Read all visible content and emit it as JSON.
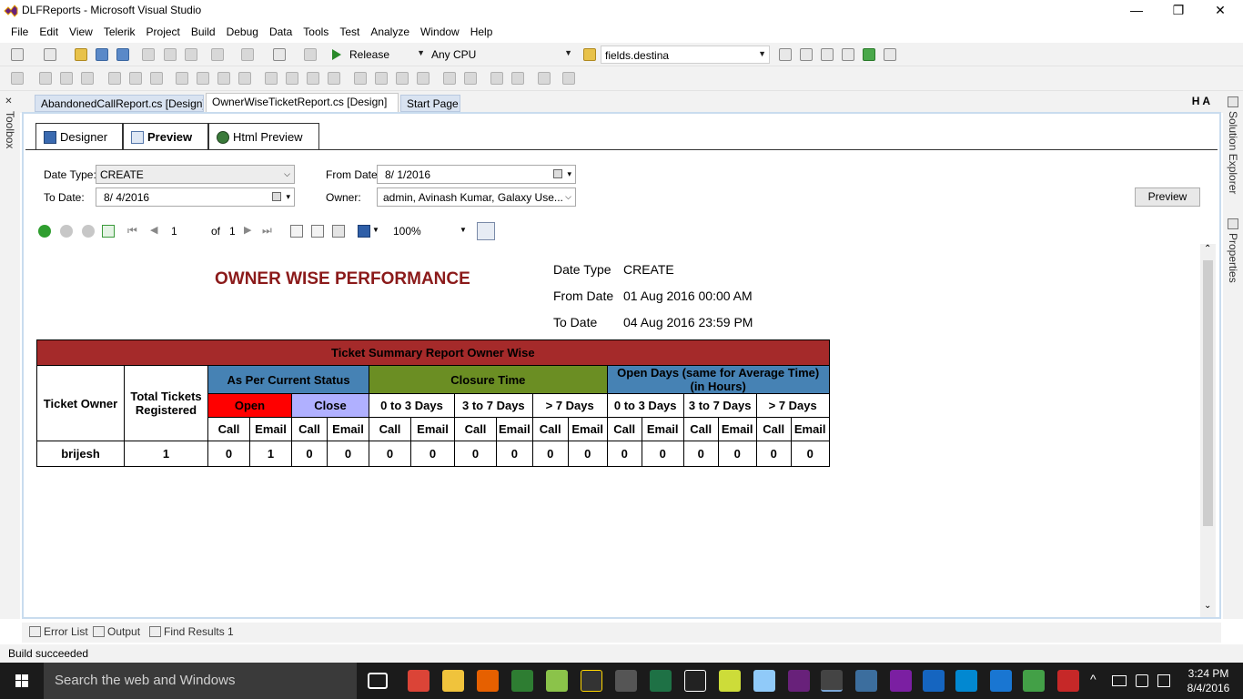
{
  "window": {
    "title": "DLFReports - Microsoft Visual Studio",
    "minimize": "—",
    "restore": "❐",
    "close": "✕"
  },
  "menu": [
    "File",
    "Edit",
    "View",
    "Telerik",
    "Project",
    "Build",
    "Debug",
    "Data",
    "Tools",
    "Test",
    "Analyze",
    "Window",
    "Help"
  ],
  "toolbar": {
    "configuration": "Release",
    "platform": "Any CPU",
    "find": "fields.destina"
  },
  "side": {
    "toolbox": "Toolbox",
    "solution_explorer": "Solution Explorer",
    "properties": "Properties"
  },
  "doc_tabs": [
    {
      "label": "AbandonedCallReport.cs [Design]",
      "active": false
    },
    {
      "label": "OwnerWiseTicketReport.cs [Design]",
      "active": true
    },
    {
      "label": "Start Page",
      "active": false
    }
  ],
  "doc_tab_extra": "H A",
  "view_tabs": [
    "Designer",
    "Preview",
    "Html Preview"
  ],
  "params": {
    "date_type_label": "Date Type:",
    "date_type_value": "CREATE",
    "to_date_label": "To Date:",
    "to_date_value": "8/  4/2016",
    "from_date_label": "From Date:",
    "from_date_value": "8/  1/2016",
    "owner_label": "Owner:",
    "owner_value": "admin, Avinash Kumar, Galaxy Use...",
    "preview_button": "Preview"
  },
  "report_toolbar": {
    "page": "1",
    "of_label": "of",
    "total_pages": "1",
    "zoom": "100%"
  },
  "report": {
    "title": "OWNER WISE PERFORMANCE",
    "meta": [
      {
        "label": "Date Type",
        "value": "CREATE"
      },
      {
        "label": "From Date",
        "value": "01 Aug 2016 00:00 AM"
      },
      {
        "label": "To Date",
        "value": "04 Aug 2016 23:59 PM"
      }
    ],
    "table": {
      "caption": "Ticket Summary Report Owner Wise",
      "owner_header": "Ticket Owner",
      "total_header": "Total Tickets Registered",
      "group_status": "As Per Current Status",
      "group_closure": "Closure Time",
      "group_open_days": "Open Days (same for Average Time) (in Hours)",
      "status_open": "Open",
      "status_close": "Close",
      "range_0_3": "0 to 3 Days",
      "range_3_7": "3 to 7 Days",
      "range_7": "> 7 Days",
      "call": "Call",
      "email": "Email",
      "rows": [
        {
          "owner": "brijesh",
          "total": "1",
          "values": [
            "0",
            "1",
            "0",
            "0",
            "0",
            "0",
            "0",
            "0",
            "0",
            "0",
            "0",
            "0",
            "0",
            "0",
            "0",
            "0"
          ]
        }
      ],
      "colors": {
        "caption": "#a52a2a",
        "status": "#4682b4",
        "closure": "#6b8e23",
        "open_days": "#4682b4",
        "open": "#ff0000",
        "close": "#b0b0ff"
      }
    }
  },
  "bottom_tabs": [
    "Error List",
    "Output",
    "Find Results 1"
  ],
  "status": "Build succeeded",
  "taskbar": {
    "search_placeholder": "Search the web and Windows",
    "time": "3:24 PM",
    "date": "8/4/2016"
  }
}
